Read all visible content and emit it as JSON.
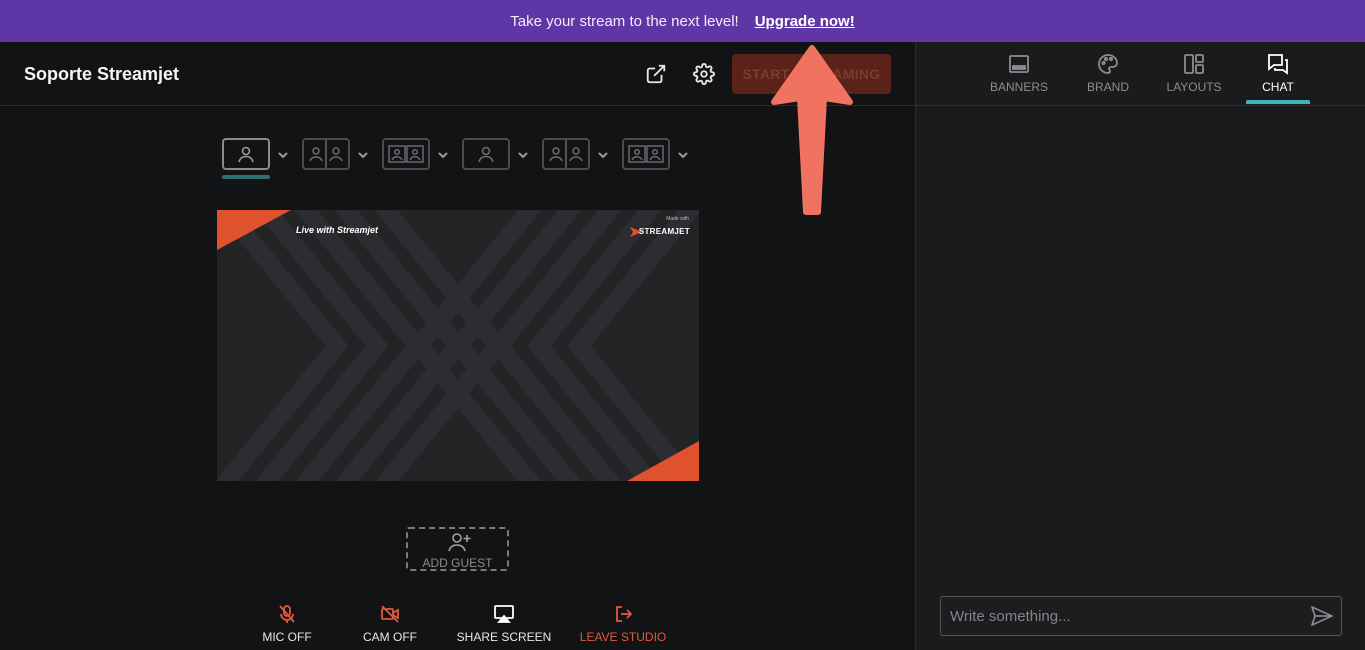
{
  "banner": {
    "text": "Take your stream to the next level!",
    "upgrade_link": "Upgrade now!",
    "bg_color": "#5f36a6"
  },
  "header": {
    "title": "Soporte Streamjet",
    "popout_icon": "external-link-icon",
    "settings_icon": "gear-icon",
    "start_button": "START STREAMING"
  },
  "layouts": [
    {
      "name": "single",
      "icon": "layout-single-icon",
      "active": true
    },
    {
      "name": "two-split",
      "icon": "layout-two-icon",
      "active": false
    },
    {
      "name": "two-framed",
      "icon": "layout-two-framed-icon",
      "active": false
    },
    {
      "name": "single-small",
      "icon": "layout-single-small-icon",
      "active": false
    },
    {
      "name": "two-split-alt",
      "icon": "layout-two-alt-icon",
      "active": false
    },
    {
      "name": "two-framed-alt",
      "icon": "layout-two-framed-alt-icon",
      "active": false
    }
  ],
  "preview": {
    "overlay_title": "Live with Streamjet",
    "made_with": "Made with",
    "brand": "STREAMJET",
    "accent_color": "#e0512e"
  },
  "add_guest": {
    "label": "ADD GUEST",
    "icon": "add-user-icon"
  },
  "controls": [
    {
      "label": "MIC OFF",
      "icon": "mic-off-icon",
      "color": "#e2593d"
    },
    {
      "label": "CAM OFF",
      "icon": "camera-off-icon",
      "color": "#e2593d"
    },
    {
      "label": "SHARE SCREEN",
      "icon": "screen-share-icon",
      "color": "#ffffff"
    },
    {
      "label": "LEAVE STUDIO",
      "icon": "exit-icon",
      "color": "#e2593d"
    }
  ],
  "sidebar": {
    "tabs": [
      {
        "label": "BANNERS",
        "icon": "banner-icon",
        "active": false
      },
      {
        "label": "BRAND",
        "icon": "palette-icon",
        "active": false
      },
      {
        "label": "LAYOUTS",
        "icon": "layouts-icon",
        "active": false
      },
      {
        "label": "CHAT",
        "icon": "chat-icon",
        "active": true
      }
    ],
    "chat_placeholder": "Write something...",
    "send_icon": "send-icon"
  },
  "annotation": {
    "icon": "up-arrow-annotation",
    "color": "#f07361"
  }
}
